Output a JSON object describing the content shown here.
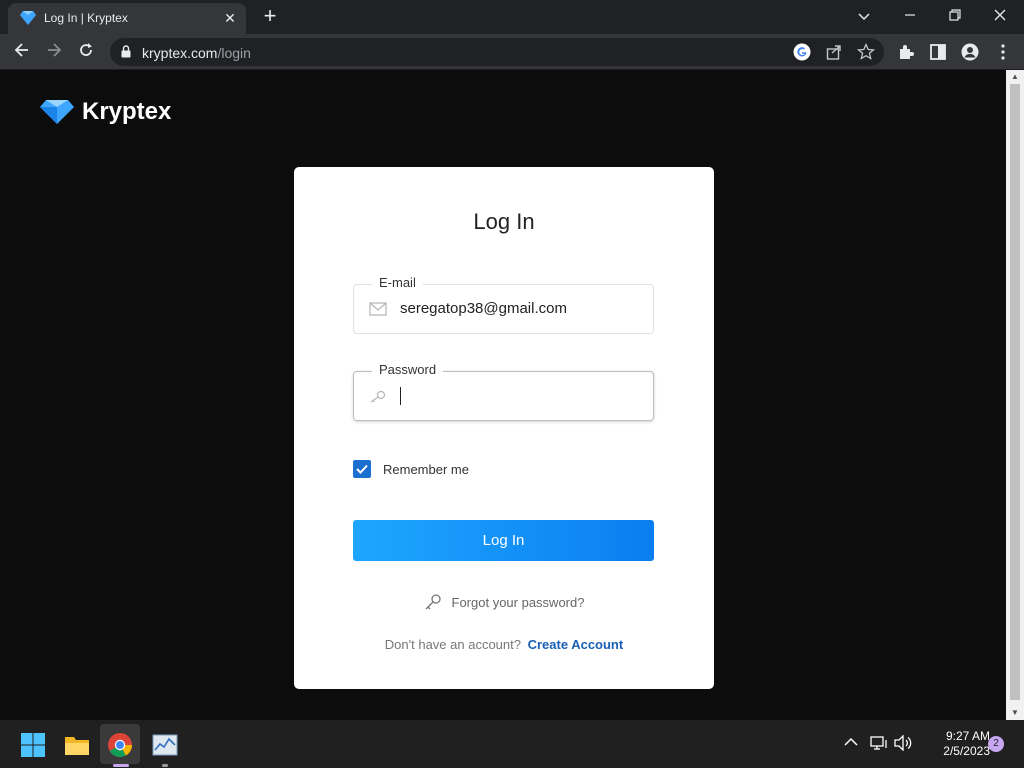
{
  "browser": {
    "tab_title": "Log In | Kryptex",
    "tab_close": "✕",
    "new_tab": "+",
    "url_domain": "kryptex.com",
    "url_path": "/login"
  },
  "page": {
    "logo_text": "Kryptex",
    "brand_color": "#3fa6ff",
    "form": {
      "title": "Log In",
      "email_label": "E-mail",
      "email_value": "seregatop38@gmail.com",
      "password_label": "Password",
      "password_value": "",
      "remember_label": "Remember me",
      "remember_checked": true,
      "login_button": "Log In",
      "forgot_link": "Forgot your password?",
      "signup_prompt": "Don't have an account?",
      "signup_link": "Create Account",
      "button_color": "#0a7ef0",
      "link_color": "#1a5fb4"
    }
  },
  "taskbar": {
    "time": "9:27 AM",
    "date": "2/5/2023",
    "notification_count": "2",
    "icons": [
      "windows-start-icon",
      "file-explorer-icon",
      "chrome-icon",
      "task-manager-icon"
    ]
  }
}
